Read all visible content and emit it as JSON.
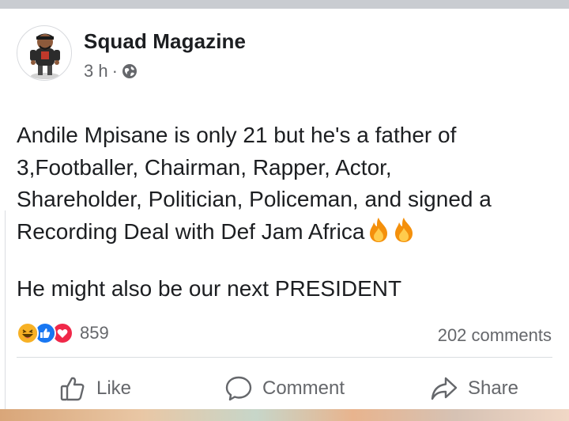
{
  "post": {
    "author": "Squad Magazine",
    "time": "3 h",
    "separator": "·",
    "audience_icon": "globe-icon",
    "body_lines": [
      "Andile Mpisane is only 21 but he's a father of",
      "3,Footballer, Chairman, Rapper, Actor,",
      "Shareholder, Politician, Policeman, and signed a",
      "Recording Deal with Def Jam Africa"
    ],
    "body_emoji": [
      "fire-icon",
      "fire-icon"
    ],
    "second_paragraph": "He might also be our next PRESIDENT"
  },
  "reactions": {
    "icons": [
      "haha-icon",
      "like-icon",
      "love-icon"
    ],
    "count": "859",
    "comments": "202 comments"
  },
  "actions": {
    "like": "Like",
    "comment": "Comment",
    "share": "Share"
  },
  "colors": {
    "primary_text": "#1c1e21",
    "secondary_text": "#65676b",
    "like_blue": "#1877f2",
    "love_red": "#f02849",
    "haha_yellow": "#f7b125",
    "fire_orange": "#f4900c",
    "divider": "#dadde1"
  }
}
